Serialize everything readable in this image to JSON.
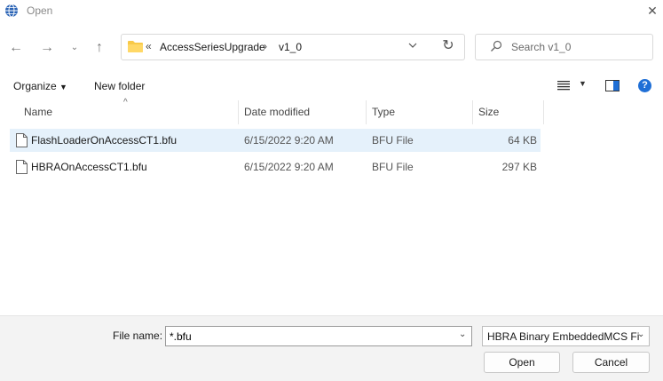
{
  "window": {
    "title": "Open"
  },
  "address": {
    "overflow_glyph": "«",
    "crumbs": [
      "AccessSeriesUpgrade",
      "v1_0"
    ],
    "separator": "›"
  },
  "search": {
    "placeholder": "Search v1_0"
  },
  "toolbar": {
    "organize_label": "Organize",
    "new_folder_label": "New folder"
  },
  "columns": {
    "name": "Name",
    "date": "Date modified",
    "type": "Type",
    "size": "Size"
  },
  "files": [
    {
      "name": "FlashLoaderOnAccessCT1.bfu",
      "date": "6/15/2022 9:20 AM",
      "type": "BFU File",
      "size": "64 KB",
      "selected": true
    },
    {
      "name": "HBRAOnAccessCT1.bfu",
      "date": "6/15/2022 9:20 AM",
      "type": "BFU File",
      "size": "297 KB",
      "selected": false
    }
  ],
  "bottom": {
    "filename_label": "File name:",
    "filename_value": "*.bfu",
    "filetype_value": "HBRA Binary EmbeddedMCS Fi",
    "open_label": "Open",
    "cancel_label": "Cancel"
  },
  "colors": {
    "accent": "#1f6fd6",
    "selection": "#e5f1fb",
    "folder": "#f8c948"
  }
}
